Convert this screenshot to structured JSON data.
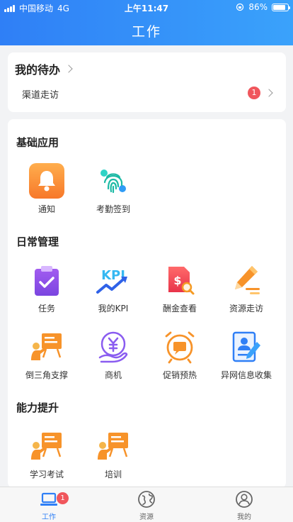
{
  "status_bar": {
    "carrier": "中国移动",
    "network": "4G",
    "time": "上午11:47",
    "battery": "86%",
    "battery_level": 0.86
  },
  "header": {
    "title": "工作"
  },
  "todo": {
    "title": "我的待办",
    "items": [
      {
        "label": "渠道走访",
        "count": "1"
      }
    ]
  },
  "sections": [
    {
      "title": "基础应用",
      "items": [
        {
          "label": "通知",
          "icon": "bell-icon"
        },
        {
          "label": "考勤签到",
          "icon": "fingerprint-icon"
        }
      ]
    },
    {
      "title": "日常管理",
      "items": [
        {
          "label": "任务",
          "icon": "task-clipboard-icon"
        },
        {
          "label": "我的KPI",
          "icon": "kpi-icon"
        },
        {
          "label": "酬金查看",
          "icon": "commission-doc-icon"
        },
        {
          "label": "资源走访",
          "icon": "pencil-icon"
        },
        {
          "label": "倒三角支撑",
          "icon": "presentation-icon"
        },
        {
          "label": "商机",
          "icon": "yuan-hand-icon"
        },
        {
          "label": "促销预热",
          "icon": "alarm-clock-icon"
        },
        {
          "label": "异网信息收集",
          "icon": "profile-form-icon"
        }
      ]
    },
    {
      "title": "能力提升",
      "items": [
        {
          "label": "学习考试",
          "icon": "presentation-icon"
        },
        {
          "label": "培训",
          "icon": "presentation-icon"
        }
      ]
    }
  ],
  "tabs": [
    {
      "label": "工作",
      "icon": "laptop-icon",
      "badge": "1",
      "active": true
    },
    {
      "label": "资源",
      "icon": "globe-icon",
      "active": false
    },
    {
      "label": "我的",
      "icon": "user-icon",
      "active": false
    }
  ],
  "colors": {
    "header_start": "#2f7ff6",
    "header_end": "#3aa2fb",
    "accent": "#2f7ff6",
    "badge": "#f0565c"
  }
}
